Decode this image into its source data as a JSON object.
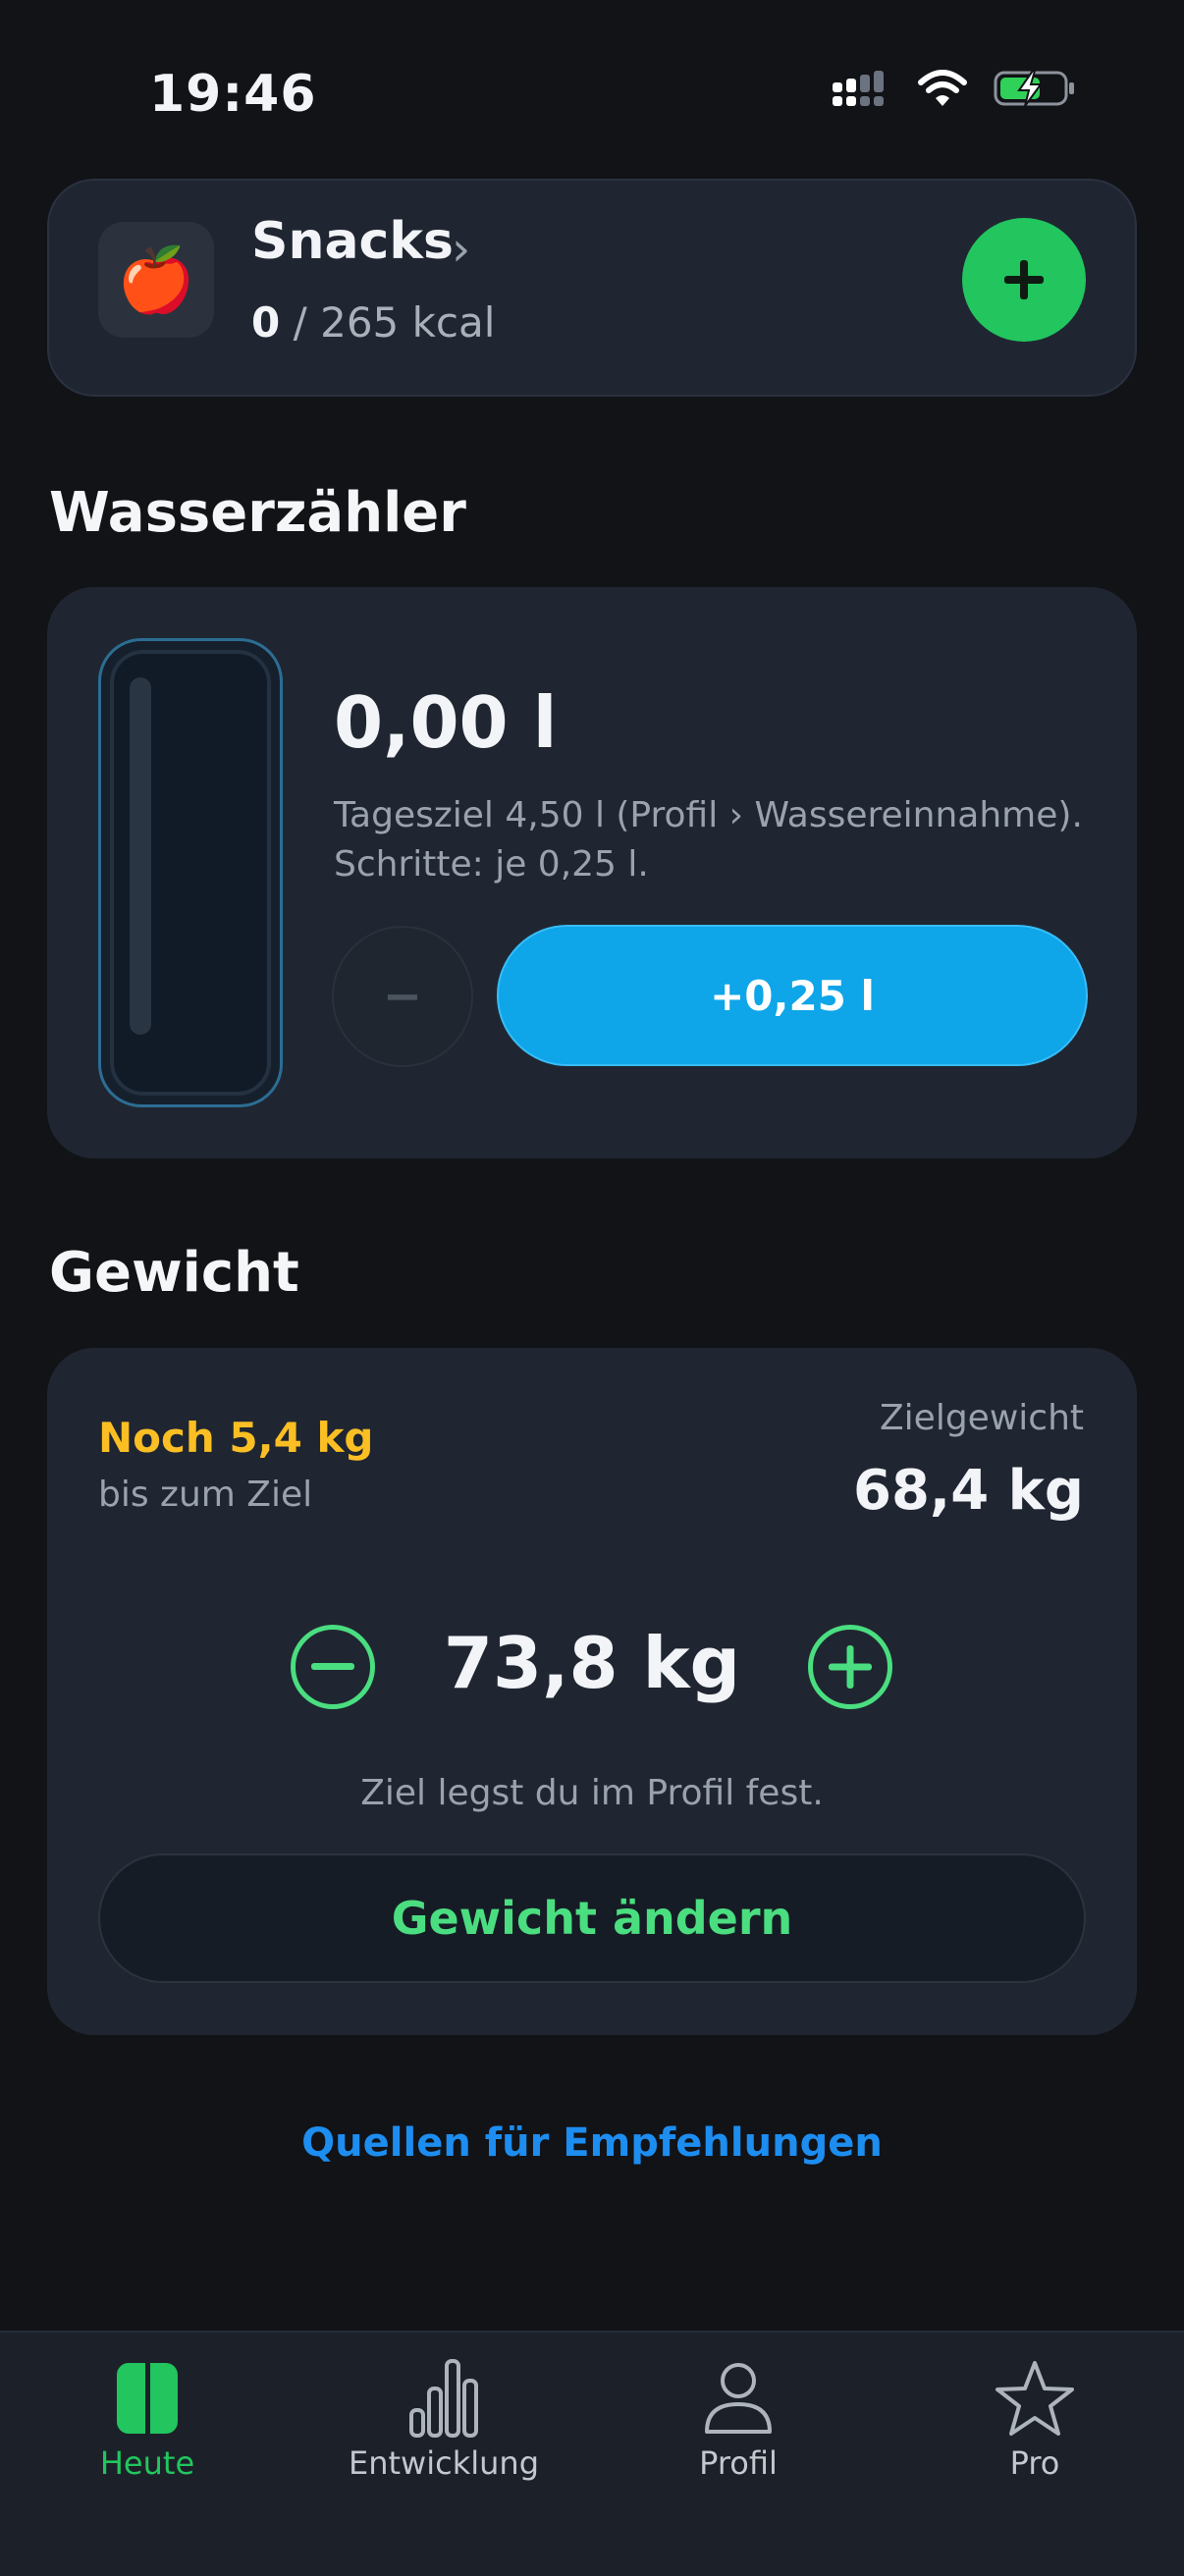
{
  "status_bar": {
    "time": "19:46"
  },
  "snacks": {
    "emoji": "🍎",
    "name": "Snacks",
    "chevron": "›",
    "current": "0",
    "goal": "/ 265 kcal"
  },
  "water": {
    "section_title": "Wasserzähler",
    "amount": "0,00 l",
    "description": "Tagesziel 4,50 l (Profil › Wassereinnahme). Schritte: je 0,25 l.",
    "minus_label": "−",
    "add_label": "+0,25 l",
    "fill_fraction": 0
  },
  "weight": {
    "section_title": "Gewicht",
    "remaining": "Noch 5,4 kg",
    "remaining_sub": "bis zum Ziel",
    "target_label": "Zielgewicht",
    "target_value": "68,4 kg",
    "current_value": "73,8 kg",
    "hint": "Ziel legst du im Profil fest.",
    "change_button": "Gewicht ändern"
  },
  "sources_link": "Quellen für Empfehlungen",
  "tabs": [
    {
      "label": "Heute",
      "icon": "today-icon",
      "active": true
    },
    {
      "label": "Entwicklung",
      "icon": "bar-chart-icon",
      "active": false
    },
    {
      "label": "Profil",
      "icon": "person-icon",
      "active": false
    },
    {
      "label": "Pro",
      "icon": "star-icon",
      "active": false
    }
  ],
  "colors": {
    "accent_green": "#22c55e",
    "water_blue": "#0ea5e9",
    "warning": "#fbbf24",
    "link": "#1d8df0"
  }
}
